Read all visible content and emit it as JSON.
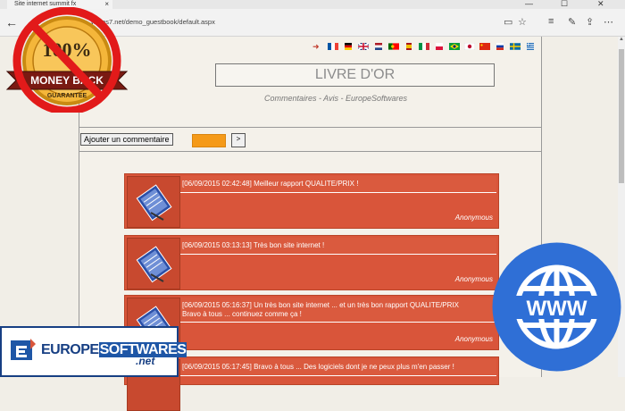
{
  "browser": {
    "tab_title": "Site internet summit fx",
    "address": "wares7.net/demo_guestbook/default.aspx",
    "minimize_glyph": "—",
    "maximize_glyph": "☐",
    "close_glyph": "✕",
    "back_glyph": "←"
  },
  "page": {
    "title": "LIVRE D'OR",
    "subtitle": "Commentaires - Avis - EuropeSoftwares",
    "add_button_label": "Ajouter un commentaire",
    "go_button_label": ">",
    "accent_color": "#d9553a",
    "orange_color": "#f59a18"
  },
  "flags": [
    "arrow",
    "fr",
    "de",
    "gb",
    "nl",
    "pt",
    "es",
    "it",
    "pl",
    "br",
    "jp",
    "cn",
    "ru",
    "se",
    "gr"
  ],
  "entries": [
    {
      "text": "[06/09/2015 02:42:48] Meilleur rapport QUALITE/PRIX !",
      "author": "Anonymous"
    },
    {
      "text": "[06/09/2015 03:13:13] Très bon site internet !",
      "author": "Anonymous"
    },
    {
      "text": "[06/09/2015 05:16:37] Un très bon site internet ... et un très bon rapport QUALITE/PRIX",
      "text2": "Bravo à tous ... continuez comme ça !",
      "author": "Anonymous"
    },
    {
      "text": "[06/09/2015 05:17:45] Bravo à tous ... Des logiciels dont je ne peux plus m'en passer !",
      "author": ""
    }
  ],
  "overlays": {
    "badge_top": "100%",
    "badge_mid": "MONEY BACK",
    "badge_bottom": "GUARANTEE",
    "www_text": "WWW",
    "logo_europe": "EUROPE",
    "logo_softwares": "SOFTWARES",
    "logo_net": ".net"
  }
}
